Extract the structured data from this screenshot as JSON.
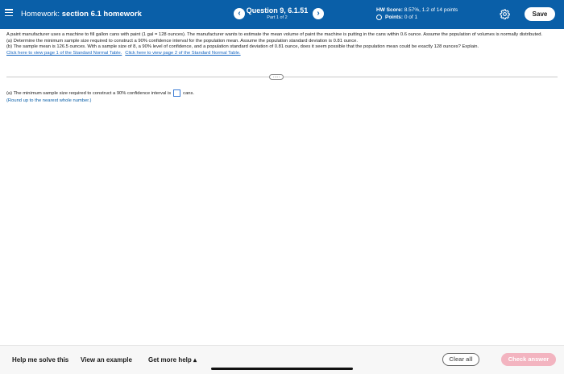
{
  "header": {
    "title_prefix": "Homework:",
    "title": "section 6.1 homework",
    "question_title": "Question 9, 6.1.51",
    "question_part": "Part 1 of 2",
    "prev_icon": "chevron-left-icon",
    "next_icon": "chevron-right-icon",
    "hw_score_label": "HW Score:",
    "hw_score_value": "8.57%, 1.2 of 14 points",
    "points_label": "Points:",
    "points_value": "0 of 1",
    "save_label": "Save",
    "accent_color": "#0a5fa8"
  },
  "problem": {
    "text": "A paint manufacturer uses a machine to fill gallon cans with paint (1 gal = 128 ounces). The manufacturer wants to estimate the mean volume of paint the machine is putting in the cans within 0.6 ounce. Assume the population of volumes is normally distributed.",
    "part_a": "(a) Determine the minimum sample size required to construct a 90% confidence interval for the population mean. Assume the population standard deviation is 0.81 ounce.",
    "part_b": "(b) The sample mean is 126.5 ounces. With a sample size of 8, a 90% level of confidence, and a population standard deviation of 0.81 ounce, does it seem possible that the population mean could be exactly 128 ounces? Explain.",
    "link_1": "Click here to view page 1 of the Standard Normal Table.",
    "link_2": "Click here to view page 2 of the Standard Normal Table.",
    "more_label": "....."
  },
  "answer": {
    "prompt": "(a) The minimum sample size required to construct a 90% confidence interval is",
    "value": "",
    "unit": "cans.",
    "hint": "(Round up to the nearest whole number.)"
  },
  "footer": {
    "help_label": "Help me solve this",
    "example_label": "View an example",
    "more_help_label": "Get more help ▴",
    "clear_label": "Clear all",
    "check_label": "Check answer",
    "check_color": "#f3b4c0"
  }
}
